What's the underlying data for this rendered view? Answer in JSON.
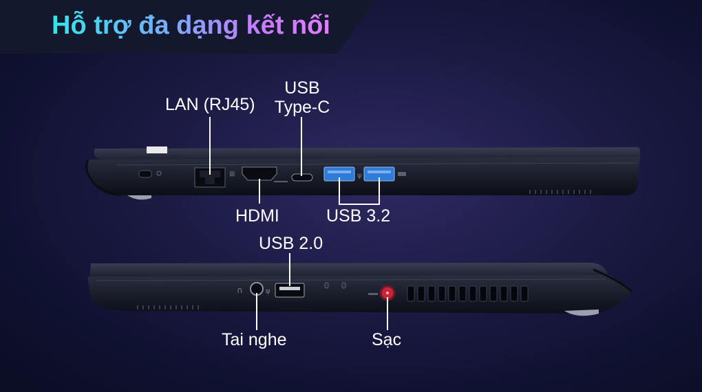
{
  "header": {
    "title": "Hỗ trợ đa dạng kết nối"
  },
  "ports": {
    "lan": "LAN (RJ45)",
    "usb_c_line1": "USB",
    "usb_c_line2": "Type-C",
    "hdmi": "HDMI",
    "usb32": "USB 3.2",
    "usb20": "USB 2.0",
    "headphone": "Tai nghe",
    "charge": "Sạc"
  },
  "colors": {
    "background": "#1c1b45",
    "usb3_blue": "#2e7bd8",
    "charge_red": "#c8243a",
    "title_gradient": [
      "#31e6ea",
      "#e37cff"
    ]
  },
  "icons": [
    "kensington-lock-icon",
    "network-icon",
    "usb-symbol-icon",
    "headphone-icon",
    "led-indicator-icon"
  ]
}
